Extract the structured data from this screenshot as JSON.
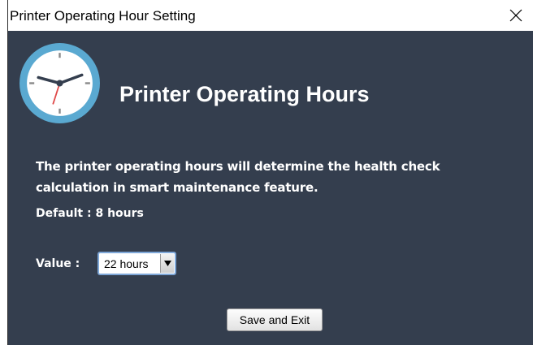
{
  "window": {
    "title": "Printer Operating Hour Setting",
    "close_icon": "close-icon"
  },
  "header": {
    "icon": "clock-icon",
    "title": "Printer Operating Hours"
  },
  "description": {
    "line1": "The printer operating hours will determine the health check",
    "line2": "calculation in smart maintenance feature."
  },
  "default_text": "Default : 8 hours",
  "value_field": {
    "label": "Value :",
    "selected": "22 hours",
    "arrow_icon": "dropdown-arrow-icon"
  },
  "actions": {
    "save_label": "Save and Exit"
  },
  "colors": {
    "background": "#343e4e",
    "clock_ring": "#5aa9d1",
    "text": "#ffffff"
  }
}
